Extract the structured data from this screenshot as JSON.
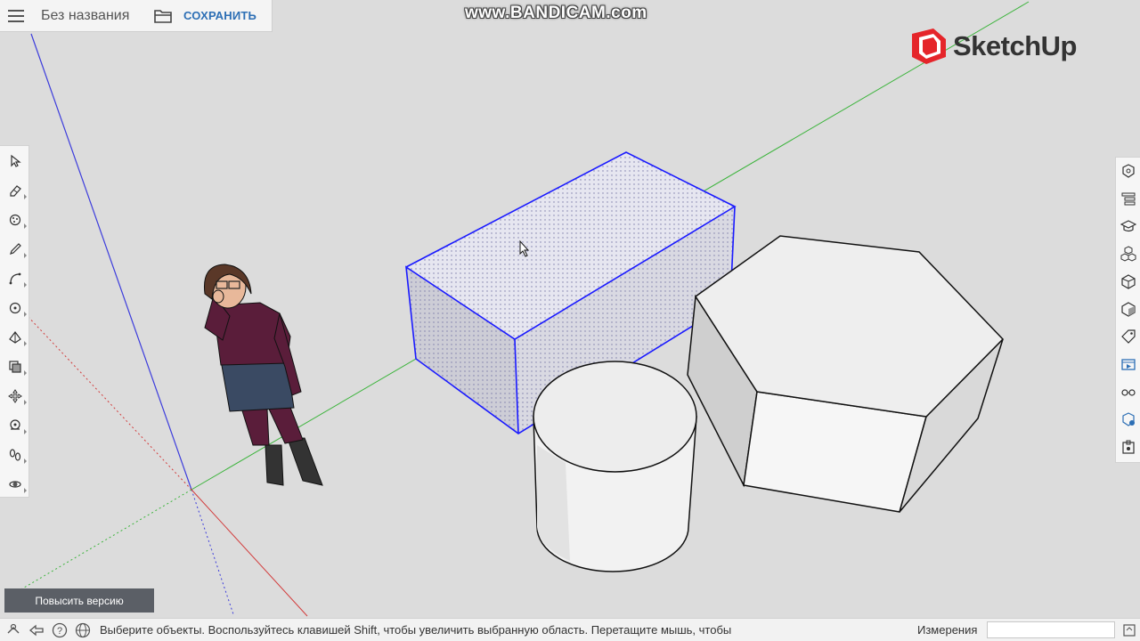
{
  "header": {
    "menu_icon": "hamburger-menu-icon",
    "title": "Без названия",
    "folder_icon": "folder-icon",
    "save_label": "СОХРАНИТЬ"
  },
  "watermark": "www.BANDICAM.com",
  "brand": {
    "name": "SketchUp",
    "logo_color": "#e5252a"
  },
  "left_toolbar": [
    {
      "name": "select-tool-icon"
    },
    {
      "name": "eraser-tool-icon"
    },
    {
      "name": "paint-bucket-tool-icon"
    },
    {
      "name": "pencil-tool-icon"
    },
    {
      "name": "arc-tool-icon"
    },
    {
      "name": "push-pull-tool-icon"
    },
    {
      "name": "pyramid-tool-icon"
    },
    {
      "name": "offset-tool-icon"
    },
    {
      "name": "move-tool-icon"
    },
    {
      "name": "tape-measure-tool-icon"
    },
    {
      "name": "walk-tool-icon"
    },
    {
      "name": "orbit-tool-icon"
    }
  ],
  "right_toolbar": [
    {
      "name": "entity-info-icon"
    },
    {
      "name": "outliner-icon"
    },
    {
      "name": "instructor-icon"
    },
    {
      "name": "components-icon"
    },
    {
      "name": "materials-icon"
    },
    {
      "name": "styles-icon"
    },
    {
      "name": "tags-icon"
    },
    {
      "name": "scenes-icon"
    },
    {
      "name": "display-icon"
    },
    {
      "name": "3d-warehouse-icon"
    },
    {
      "name": "extension-icon"
    }
  ],
  "upgrade_label": "Повысить версию",
  "statusbar": {
    "hint": "Выберите объекты. Воспользуйтесь клавишей Shift, чтобы увеличить выбранную область. Перетащите мышь, чтобы",
    "measurements_label": "Измерения",
    "measurements_value": ""
  },
  "colors": {
    "background": "#dcdcdc",
    "selection": "#1a1aff",
    "axis_red": "#d23c3c",
    "axis_green": "#3cb43c",
    "axis_blue": "#3c3cdc",
    "accent": "#2d6fb5"
  }
}
